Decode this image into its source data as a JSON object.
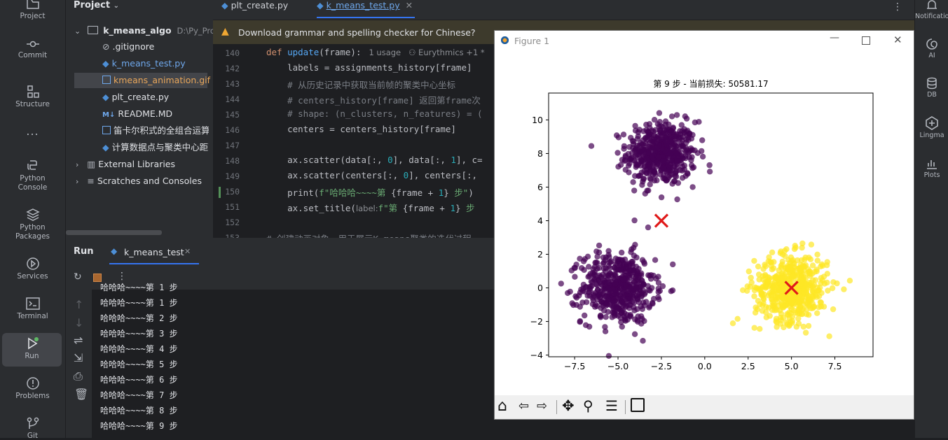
{
  "leftbar": {
    "items": [
      {
        "label": "Project",
        "icon": "folder-icon"
      },
      {
        "label": "Commit",
        "icon": "commit-icon"
      },
      {
        "label": "Structure",
        "icon": "structure-icon"
      },
      {
        "label": "...",
        "icon": "more-icon"
      },
      {
        "label": "Python Console",
        "icon": "python-console-icon"
      },
      {
        "label": "Python Packages",
        "icon": "python-packages-icon"
      },
      {
        "label": "Services",
        "icon": "services-icon"
      },
      {
        "label": "Terminal",
        "icon": "terminal-icon"
      },
      {
        "label": "Run",
        "icon": "run-icon"
      },
      {
        "label": "Problems",
        "icon": "problems-icon"
      },
      {
        "label": "Git",
        "icon": "git-icon"
      }
    ]
  },
  "rightbar": {
    "items": [
      {
        "label": "Notifications",
        "icon": "bell-icon"
      },
      {
        "label": "AI",
        "icon": "ai-icon"
      },
      {
        "label": "DB",
        "icon": "database-icon"
      },
      {
        "label": "Lingma",
        "icon": "lingma-icon"
      },
      {
        "label": "Plots",
        "icon": "plots-icon"
      }
    ]
  },
  "project": {
    "title": "Project",
    "root": "k_means_algo",
    "root_path": "D:\\Py_Projects",
    "files": [
      ".gitignore",
      "k_means_test.py",
      "kmeans_animation.gif",
      "plt_create.py",
      "README.MD",
      "笛卡尔积式的全组合运算.py",
      "计算数据点与聚类中心距离.py"
    ],
    "external": "External Libraries",
    "scratches": "Scratches and Consoles"
  },
  "editor": {
    "tabs": [
      "plt_create.py",
      "k_means_test.py"
    ],
    "banner": "Download grammar and spelling checker for Chinese?",
    "lines": [
      {
        "n": "140",
        "parts": [
          [
            "kw",
            "def "
          ],
          [
            "fn",
            "update"
          ],
          [
            "",
            "(frame):"
          ],
          [
            "hint",
            "   1 usage   ⚇ Eurythmics +1 *"
          ]
        ]
      },
      {
        "n": "142",
        "parts": [
          [
            "",
            "    labels = assignments_history[frame]"
          ]
        ]
      },
      {
        "n": "143",
        "parts": [
          [
            "cm",
            "    # 从历史记录中获取当前帧的聚类中心坐标"
          ]
        ]
      },
      {
        "n": "144",
        "parts": [
          [
            "cm",
            "    # centers_history[frame] 返回第frame次"
          ]
        ]
      },
      {
        "n": "145",
        "parts": [
          [
            "cm",
            "    # shape: (n_clusters, n_features) = ("
          ]
        ]
      },
      {
        "n": "146",
        "parts": [
          [
            "",
            "    centers = centers_history[frame]"
          ]
        ]
      },
      {
        "n": "147",
        "parts": [
          [
            "",
            ""
          ]
        ]
      },
      {
        "n": "148",
        "parts": [
          [
            "",
            "    ax.scatter(data[:, "
          ],
          [
            "nm",
            "0"
          ],
          [
            "",
            "], data[:, "
          ],
          [
            "nm",
            "1"
          ],
          [
            "",
            "], c="
          ]
        ]
      },
      {
        "n": "149",
        "parts": [
          [
            "",
            "    ax.scatter(centers[:, "
          ],
          [
            "nm",
            "0"
          ],
          [
            "",
            "], centers[:,"
          ]
        ]
      },
      {
        "n": "150",
        "parts": [
          [
            "",
            "    print("
          ],
          [
            "st",
            "f\"哈哈哈~~~~第 "
          ],
          [
            "",
            "{frame + "
          ],
          [
            "nm",
            "1"
          ],
          [
            "",
            "}"
          ],
          [
            "st",
            " 步\""
          ],
          [
            "",
            ")"
          ]
        ]
      },
      {
        "n": "151",
        "parts": [
          [
            "",
            "    ax.set_title("
          ],
          [
            "hint",
            "label:"
          ],
          [
            "st",
            "f\"第 "
          ],
          [
            "",
            "{frame + "
          ],
          [
            "nm",
            "1"
          ],
          [
            "",
            "}"
          ],
          [
            "st",
            " 步"
          ]
        ]
      },
      {
        "n": "152",
        "parts": [
          [
            "",
            ""
          ]
        ]
      },
      {
        "n": "153",
        "parts": [
          [
            "cm",
            "# 创建动画对象，用于展示K-means聚类的迭代过程"
          ]
        ]
      }
    ]
  },
  "run": {
    "title": "Run",
    "tab": "k_means_test",
    "output": [
      "哈哈哈~~~~第 1 步",
      "哈哈哈~~~~第 1 步",
      "哈哈哈~~~~第 2 步",
      "哈哈哈~~~~第 3 步",
      "哈哈哈~~~~第 4 步",
      "哈哈哈~~~~第 5 步",
      "哈哈哈~~~~第 6 步",
      "哈哈哈~~~~第 7 步",
      "哈哈哈~~~~第 8 步",
      "哈哈哈~~~~第 9 步"
    ]
  },
  "figure": {
    "window_title": "Figure 1",
    "toolbar": [
      "home-icon",
      "back-icon",
      "forward-icon",
      "pan-icon",
      "zoom-icon",
      "configure-icon",
      "save-icon"
    ]
  },
  "chart_data": {
    "type": "scatter",
    "title": "第 9 步 - 当前损失: 50581.17",
    "xlabel": "",
    "ylabel": "",
    "xlim": [
      -9.0,
      9.7
    ],
    "ylim": [
      -4.1,
      11.6
    ],
    "xticks": [
      "−7.5",
      "−5.0",
      "−2.5",
      "0.0",
      "2.5",
      "5.0",
      "7.5"
    ],
    "xtick_values": [
      -7.5,
      -5.0,
      -2.5,
      0.0,
      2.5,
      5.0,
      7.5
    ],
    "yticks": [
      "−4",
      "−2",
      "0",
      "2",
      "4",
      "6",
      "8",
      "10"
    ],
    "ytick_values": [
      -4,
      -2,
      0,
      2,
      4,
      6,
      8,
      10
    ],
    "clusters": [
      {
        "center": [
          -2.5,
          8.0
        ],
        "spread": [
          1.0,
          0.95
        ],
        "n": 520,
        "color": "#440154",
        "alpha": 0.7
      },
      {
        "center": [
          -5.0,
          0.0
        ],
        "spread": [
          1.05,
          1.05
        ],
        "n": 520,
        "color": "#440154",
        "alpha": 0.7
      },
      {
        "center": [
          5.0,
          0.0
        ],
        "spread": [
          1.05,
          1.0
        ],
        "n": 520,
        "color": "#fde725",
        "alpha": 0.7
      }
    ],
    "centroids": [
      [
        -2.5,
        4.0
      ],
      [
        5.0,
        0.0
      ]
    ],
    "centroid_color": "#e01a1a"
  }
}
